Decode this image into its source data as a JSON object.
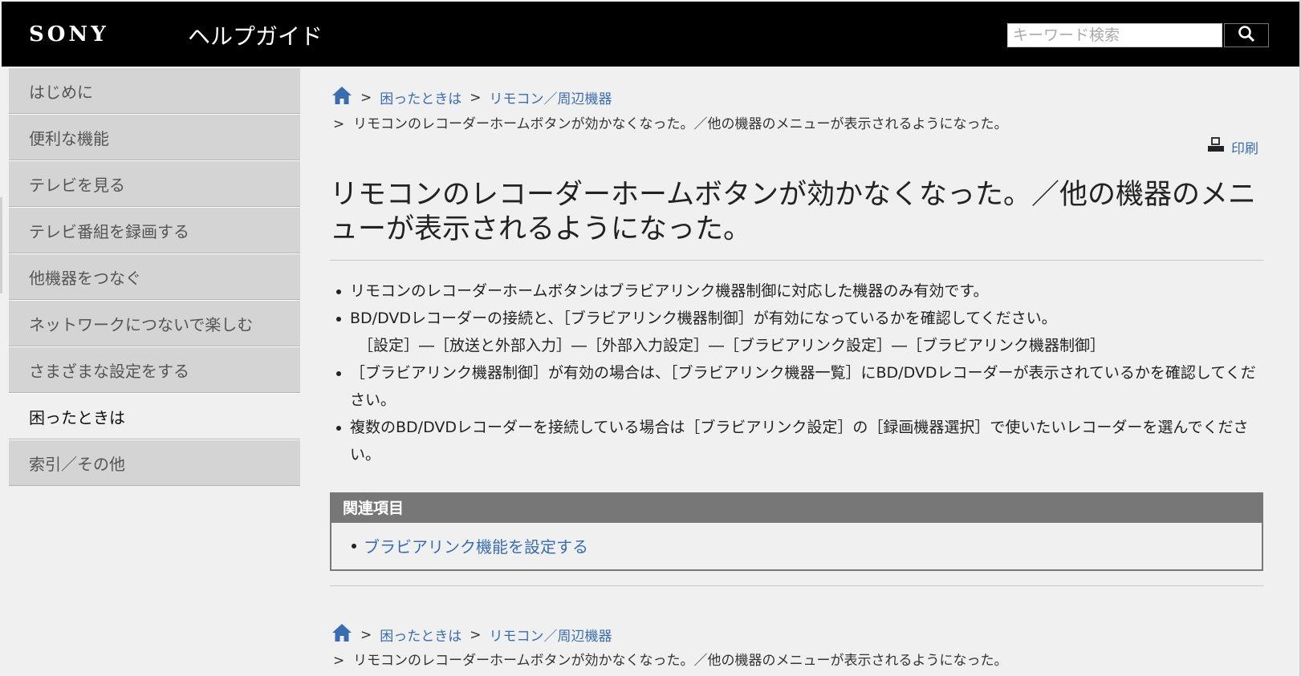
{
  "header": {
    "logo": "SONY",
    "site_title": "ヘルプガイド",
    "search_placeholder": "キーワード検索",
    "search_button": "search-icon"
  },
  "sidebar": {
    "items": [
      {
        "label": "はじめに"
      },
      {
        "label": "便利な機能"
      },
      {
        "label": "テレビを見る"
      },
      {
        "label": "テレビ番組を録画する"
      },
      {
        "label": "他機器をつなぐ"
      },
      {
        "label": "ネットワークにつないで楽しむ"
      },
      {
        "label": "さまざまな設定をする"
      },
      {
        "label": "困ったときは"
      },
      {
        "label": "索引／その他"
      }
    ],
    "active_index": 7
  },
  "breadcrumb": {
    "home_icon": "home-icon",
    "sep": ">",
    "level1": "困ったときは",
    "level2": "リモコン／周辺機器",
    "current": "リモコンのレコーダーホームボタンが効かなくなった。／他の機器のメニューが表示されるようになった。"
  },
  "print": {
    "icon": "printer-icon",
    "label": "印刷"
  },
  "main": {
    "title": "リモコンのレコーダーホームボタンが効かなくなった。／他の機器のメニューが表示されるようになった。",
    "bullets": [
      {
        "text": "リモコンのレコーダーホームボタンはブラビアリンク機器制御に対応した機器のみ有効です。"
      },
      {
        "text": "BD/DVDレコーダーの接続と、［ブラビアリンク機器制御］が有効になっているかを確認してください。",
        "sub": "［設定］―［放送と外部入力］―［外部入力設定］―［ブラビアリンク設定］―［ブラビアリンク機器制御］"
      },
      {
        "text": "［ブラビアリンク機器制御］が有効の場合は、［ブラビアリンク機器一覧］にBD/DVDレコーダーが表示されているかを確認してください。"
      },
      {
        "text": "複数のBD/DVDレコーダーを接続している場合は［ブラビアリンク設定］の［録画機器選択］で使いたいレコーダーを選んでください。"
      }
    ]
  },
  "related": {
    "heading": "関連項目",
    "links": [
      {
        "label": "ブラビアリンク機能を設定する"
      }
    ]
  },
  "colors": {
    "header_bg": "#000000",
    "link": "#3a6db0",
    "sidebar_bg": "#d4d4d4",
    "page_bg": "#f0f0f0",
    "related_head_bg": "#777777"
  }
}
